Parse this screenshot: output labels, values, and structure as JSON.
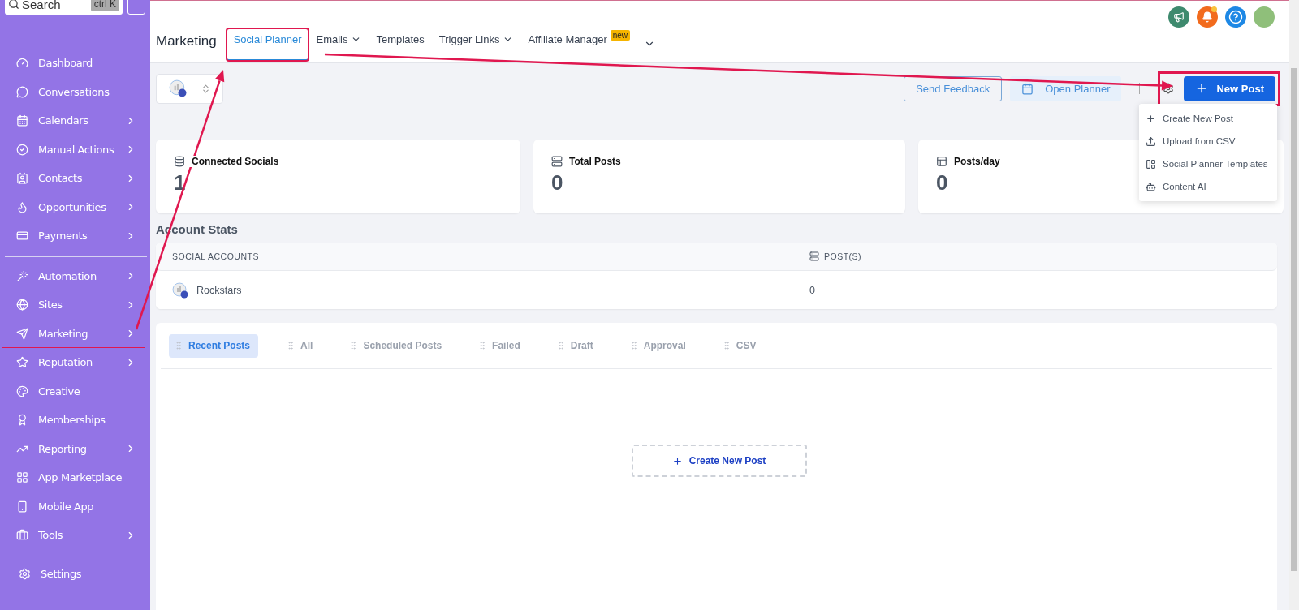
{
  "sidebar": {
    "search": {
      "placeholder": "Search",
      "shortcut": "ctrl K"
    },
    "sections": [
      {
        "items": [
          {
            "label": "Dashboard",
            "submenu": false,
            "highlighted": false
          },
          {
            "label": "Conversations",
            "submenu": false,
            "highlighted": false
          },
          {
            "label": "Calendars",
            "submenu": true,
            "highlighted": false
          },
          {
            "label": "Manual Actions",
            "submenu": true,
            "highlighted": false
          },
          {
            "label": "Contacts",
            "submenu": true,
            "highlighted": false
          },
          {
            "label": "Opportunities",
            "submenu": true,
            "highlighted": false
          },
          {
            "label": "Payments",
            "submenu": true,
            "highlighted": false
          }
        ]
      },
      {
        "items": [
          {
            "label": "Automation",
            "submenu": true,
            "highlighted": false
          },
          {
            "label": "Sites",
            "submenu": true,
            "highlighted": false
          },
          {
            "label": "Marketing",
            "submenu": true,
            "highlighted": true
          },
          {
            "label": "Reputation",
            "submenu": true,
            "highlighted": false
          },
          {
            "label": "Creative",
            "submenu": false,
            "highlighted": false
          },
          {
            "label": "Memberships",
            "submenu": false,
            "highlighted": false
          },
          {
            "label": "Reporting",
            "submenu": true,
            "highlighted": false
          },
          {
            "label": "App Marketplace",
            "submenu": false,
            "highlighted": false
          },
          {
            "label": "Mobile App",
            "submenu": false,
            "highlighted": false
          },
          {
            "label": "Tools",
            "submenu": true,
            "highlighted": false
          }
        ]
      }
    ],
    "footer_item": {
      "label": "Settings"
    }
  },
  "header": {
    "title": "Marketing",
    "tabs": [
      {
        "label": "Social Planner",
        "selected": true,
        "dropdown": false,
        "highlighted": true
      },
      {
        "label": "Emails",
        "selected": false,
        "dropdown": true,
        "highlighted": false
      },
      {
        "label": "Templates",
        "selected": false,
        "dropdown": false,
        "highlighted": false
      },
      {
        "label": "Trigger Links",
        "selected": false,
        "dropdown": true,
        "highlighted": false
      },
      {
        "label": "Affiliate Manager",
        "badge": "new",
        "selected": false,
        "dropdown": false,
        "highlighted": false
      }
    ]
  },
  "toolbar": {
    "send_feedback": "Send Feedback",
    "open_planner": "Open Planner",
    "new_post": {
      "label": "New Post",
      "highlighted": true
    },
    "menu": [
      "Create New Post",
      "Upload from CSV",
      "Social Planner Templates",
      "Content AI"
    ]
  },
  "stats": [
    {
      "label": "Connected Socials",
      "value": "1"
    },
    {
      "label": "Total Posts",
      "value": "0"
    },
    {
      "label": "Posts/day",
      "value": "0"
    }
  ],
  "account_stats": {
    "title": "Account Stats",
    "columns": [
      "SOCIAL ACCOUNTS",
      "POST(S)"
    ],
    "rows": [
      {
        "account": "Rockstars",
        "posts": "0"
      }
    ]
  },
  "post_tabs": [
    {
      "label": "Recent Posts",
      "selected": true
    },
    {
      "label": "All",
      "selected": false
    },
    {
      "label": "Scheduled Posts",
      "selected": false
    },
    {
      "label": "Failed",
      "selected": false
    },
    {
      "label": "Draft",
      "selected": false
    },
    {
      "label": "Approval",
      "selected": false
    },
    {
      "label": "CSV",
      "selected": false
    }
  ],
  "create_button": "Create New Post"
}
